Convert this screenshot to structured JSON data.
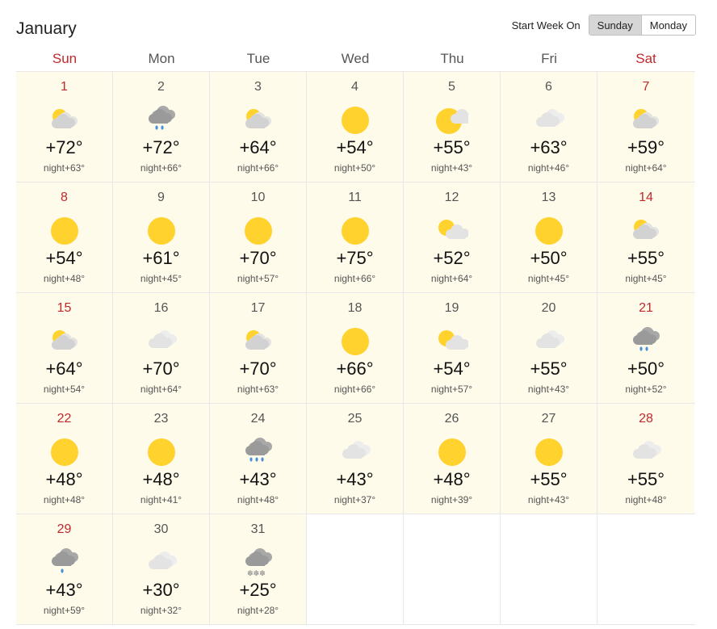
{
  "header": {
    "month": "January",
    "start_week_label": "Start Week On",
    "options": [
      "Sunday",
      "Monday"
    ],
    "selected": "Sunday"
  },
  "weekdays": [
    {
      "label": "Sun",
      "weekend": true
    },
    {
      "label": "Mon",
      "weekend": false
    },
    {
      "label": "Tue",
      "weekend": false
    },
    {
      "label": "Wed",
      "weekend": false
    },
    {
      "label": "Thu",
      "weekend": false
    },
    {
      "label": "Fri",
      "weekend": false
    },
    {
      "label": "Sat",
      "weekend": true
    }
  ],
  "night_label": "night",
  "days": [
    {
      "day": "1",
      "icon": "partly-cloudy",
      "temp": "+72°",
      "night": "+63°"
    },
    {
      "day": "2",
      "icon": "rain",
      "temp": "+72°",
      "night": "+66°"
    },
    {
      "day": "3",
      "icon": "partly-cloudy",
      "temp": "+64°",
      "night": "+66°"
    },
    {
      "day": "4",
      "icon": "sunny",
      "temp": "+54°",
      "night": "+50°"
    },
    {
      "day": "5",
      "icon": "mostly-sunny",
      "temp": "+55°",
      "night": "+43°"
    },
    {
      "day": "6",
      "icon": "cloudy",
      "temp": "+63°",
      "night": "+46°"
    },
    {
      "day": "7",
      "icon": "partly-cloudy",
      "temp": "+59°",
      "night": "+64°"
    },
    {
      "day": "8",
      "icon": "sunny",
      "temp": "+54°",
      "night": "+48°"
    },
    {
      "day": "9",
      "icon": "sunny",
      "temp": "+61°",
      "night": "+45°"
    },
    {
      "day": "10",
      "icon": "sunny",
      "temp": "+70°",
      "night": "+57°"
    },
    {
      "day": "11",
      "icon": "sunny",
      "temp": "+75°",
      "night": "+66°"
    },
    {
      "day": "12",
      "icon": "sun-cloud",
      "temp": "+52°",
      "night": "+64°"
    },
    {
      "day": "13",
      "icon": "sunny",
      "temp": "+50°",
      "night": "+45°"
    },
    {
      "day": "14",
      "icon": "partly-cloudy",
      "temp": "+55°",
      "night": "+45°"
    },
    {
      "day": "15",
      "icon": "partly-cloudy",
      "temp": "+64°",
      "night": "+54°"
    },
    {
      "day": "16",
      "icon": "cloudy",
      "temp": "+70°",
      "night": "+64°"
    },
    {
      "day": "17",
      "icon": "partly-cloudy",
      "temp": "+70°",
      "night": "+63°"
    },
    {
      "day": "18",
      "icon": "sunny",
      "temp": "+66°",
      "night": "+66°"
    },
    {
      "day": "19",
      "icon": "sun-cloud",
      "temp": "+54°",
      "night": "+57°"
    },
    {
      "day": "20",
      "icon": "cloudy",
      "temp": "+55°",
      "night": "+43°"
    },
    {
      "day": "21",
      "icon": "rain",
      "temp": "+50°",
      "night": "+52°"
    },
    {
      "day": "22",
      "icon": "sunny",
      "temp": "+48°",
      "night": "+48°"
    },
    {
      "day": "23",
      "icon": "sunny",
      "temp": "+48°",
      "night": "+41°"
    },
    {
      "day": "24",
      "icon": "heavy-rain",
      "temp": "+43°",
      "night": "+48°"
    },
    {
      "day": "25",
      "icon": "cloudy",
      "temp": "+43°",
      "night": "+37°"
    },
    {
      "day": "26",
      "icon": "sunny",
      "temp": "+48°",
      "night": "+39°"
    },
    {
      "day": "27",
      "icon": "sunny",
      "temp": "+55°",
      "night": "+43°"
    },
    {
      "day": "28",
      "icon": "cloudy",
      "temp": "+55°",
      "night": "+48°"
    },
    {
      "day": "29",
      "icon": "light-rain",
      "temp": "+43°",
      "night": "+59°"
    },
    {
      "day": "30",
      "icon": "cloudy",
      "temp": "+30°",
      "night": "+32°"
    },
    {
      "day": "31",
      "icon": "snow",
      "temp": "+25°",
      "night": "+28°"
    }
  ],
  "colors": {
    "weekend": "#c0282d",
    "cell_bg": "#fffbea",
    "sun": "#ffd22e",
    "cloud_light": "#e3e3e3",
    "cloud_dark": "#a8a8a8",
    "rain": "#4a90d9"
  }
}
